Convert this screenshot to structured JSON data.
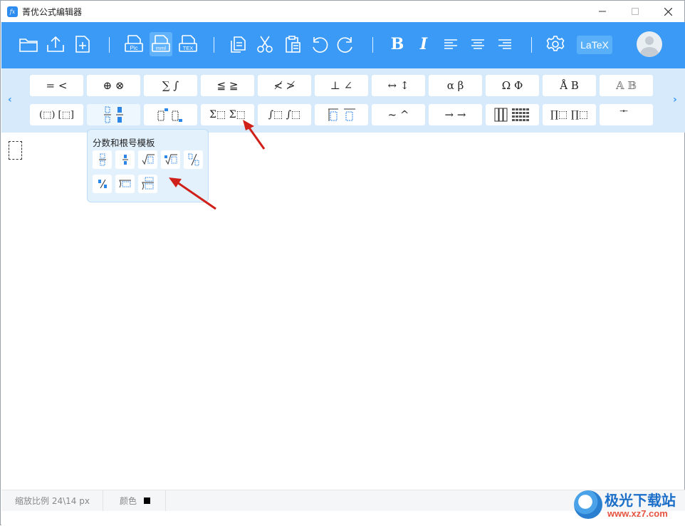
{
  "window": {
    "title": "菁优公式编辑器",
    "app_icon_text": "fx",
    "controls": {
      "minimize": "—",
      "maximize": "☐",
      "close": "✕"
    }
  },
  "toolbar": {
    "bg_color": "#3a9af5",
    "buttons": [
      {
        "name": "open-folder",
        "icon": "folder-icon"
      },
      {
        "name": "upload",
        "icon": "upload-icon"
      },
      {
        "name": "new-file",
        "icon": "new-file-icon"
      },
      {
        "name": "export-pic",
        "icon": "pic-icon",
        "label": "Pic"
      },
      {
        "name": "export-mml",
        "icon": "mml-icon",
        "label": "mml"
      },
      {
        "name": "export-tex",
        "icon": "tex-icon",
        "label": "TEX"
      },
      {
        "name": "copy",
        "icon": "copy-icon"
      },
      {
        "name": "cut",
        "icon": "scissors-icon"
      },
      {
        "name": "paste",
        "icon": "paste-icon"
      },
      {
        "name": "undo",
        "icon": "undo-icon"
      },
      {
        "name": "redo",
        "icon": "redo-icon"
      },
      {
        "name": "bold",
        "label": "B"
      },
      {
        "name": "italic",
        "label": "I"
      },
      {
        "name": "align-left",
        "icon": "align-left-icon"
      },
      {
        "name": "align-center",
        "icon": "align-center-icon"
      },
      {
        "name": "align-right",
        "icon": "align-right-icon"
      },
      {
        "name": "settings",
        "icon": "gear-icon"
      }
    ],
    "latex_label": "LaTeX"
  },
  "palette": {
    "row1": [
      "= <",
      "⊕ ⊗",
      "∑ ∫",
      "≦ ≧",
      "≮ ≯",
      "⊥ ∠",
      "↔ ↕",
      "α β",
      "Ω Φ",
      "Å B",
      "𝔸 𝔹"
    ],
    "row2": [
      "(⬚) [⬚]",
      "fraction",
      "superscript",
      "Σ⬚ Σ⬚",
      "∫⬚ ∫⬚",
      "overline",
      "~ ^",
      "→ →",
      "matrix",
      "∏⬚ ∏⬚",
      "⃗ ⃖"
    ],
    "prev_arrow": "‹",
    "next_arrow": "›"
  },
  "popup": {
    "title": "分数和根号模板",
    "tiles": [
      "a/b",
      "÷",
      "√a",
      "ⁿ√a",
      "a/b slash",
      "%",
      "root-long",
      "root-n-long"
    ]
  },
  "status": {
    "zoom": "缩放比例 24\\14 px",
    "color_label": "颜色",
    "color_value": "#000000"
  },
  "watermark": {
    "cn": "极光下载站",
    "url": "www.xz7.com"
  }
}
